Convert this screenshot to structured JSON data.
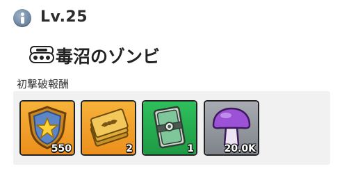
{
  "header": {
    "level_label": "Lv.25"
  },
  "unit": {
    "name": "毒沼のゾンビ"
  },
  "rewards_section": {
    "caption": "初撃破報酬",
    "items": [
      {
        "icon": "shield-star-icon",
        "amount": "550"
      },
      {
        "icon": "gold-ticket-icon",
        "amount": "2"
      },
      {
        "icon": "card-pack-icon",
        "amount": "1"
      },
      {
        "icon": "purple-mushroom-icon",
        "amount": "20.0K"
      }
    ]
  },
  "colors": {
    "orange_tile": "#ec8f1d",
    "green_tile": "#1e9a45",
    "gray_tile": "#7f848b",
    "panel": "#f1f1f1"
  }
}
